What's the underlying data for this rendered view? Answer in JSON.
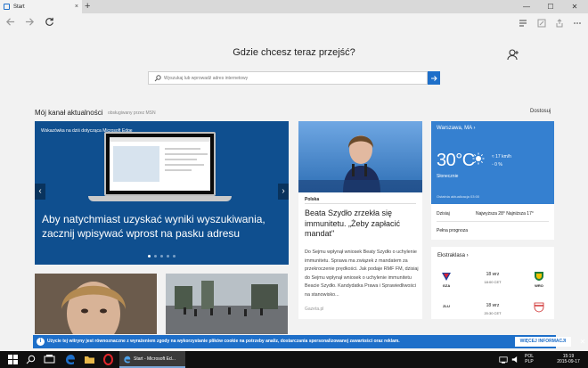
{
  "tab": {
    "title": "Start",
    "close": "×",
    "new_tab": "+"
  },
  "window_controls": {
    "minimize": "—",
    "maximize": "☐",
    "close": "✕"
  },
  "search": {
    "heading": "Gdzie chcesz teraz przejść?",
    "placeholder": "Wyszukaj lub wprowadź adres internetowy"
  },
  "feed": {
    "title": "Mój kanał aktualności",
    "subtitle": "obsługiwany przez MSN",
    "customize": "Dostosuj"
  },
  "hero": {
    "tag": "Wskazówka na dziś dotycząca Microsoft Edge",
    "caption": "Aby natychmiast uzyskać wyniki wyszukiwania, zacznij wpisywać wprost na pasku adresu",
    "prev": "‹",
    "next": "›",
    "slides": 5
  },
  "article": {
    "category": "Polska",
    "headline": "Beata Szydło zrzekła się immunitetu. „Żeby zapłacić mandat\"",
    "body": "Do Sejmu wpłynął wniosek Beaty Szydło o uchylenie immunitetu. Sprawa ma związek z mandatem za przekroczenie prędkości. Jak podaje RMF FM, dzisiaj do Sejmu wpłynął wniosek o uchylenie immunitetu Beacie Szydło. Kandydatka Prawa i Sprawiedliwości na stanowisko...",
    "source": "Gazeta.pl"
  },
  "weather": {
    "city": "Warszawa, MA",
    "chevron": "›",
    "temperature": "30°C",
    "wind": "17 km/h",
    "humidity": "0 %",
    "condition": "Słonecznie",
    "updated": "Ostatnia aktualizacja 03:00",
    "forecast_label": "Dzisiaj",
    "forecast_value": "Najwyższa 28° Najniższa 17°",
    "full_forecast": "Pełna prognoza"
  },
  "sport": {
    "title": "Ekstraklasa ›",
    "matches": [
      {
        "home": "GZA",
        "away": "WRO",
        "date": "18 wrz",
        "time": "18:00 CET"
      },
      {
        "home": "ZLU",
        "away": "CRA",
        "date": "18 wrz",
        "time": "20:30 CET"
      }
    ]
  },
  "cookie": {
    "icon": "i",
    "text": "Użycie tej witryny jest równoznaczne z wyrażeniem zgody na wykorzystanie plików cookie na potrzeby analiz, dostarczania spersonalizowanej zawartości oraz reklam.",
    "more": "WIĘCEJ INFORMACJI",
    "close": "✕"
  },
  "taskbar": {
    "active_label": "Start - Microsoft Ed...",
    "lang_1": "POL",
    "lang_2": "PLP",
    "time": "15:19",
    "date": "2015-09-17"
  },
  "colors": {
    "accent": "#1e6fc9",
    "hero_bg": "#0f4f8f",
    "weather_bg": "#3580d0"
  }
}
